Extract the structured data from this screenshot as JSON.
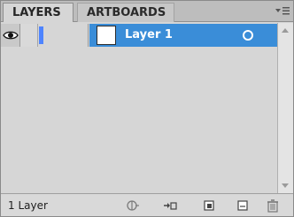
{
  "tabs": [
    "LAYERS",
    "ARTBOARDS"
  ],
  "panel_menu_icon": "panel-menu-icon",
  "layer": {
    "name": "Layer 1",
    "color": "#4e84ff",
    "visibility_icon": "eye-icon",
    "selected": true
  },
  "footer": {
    "layer_count": "1 Layer",
    "buttons": [
      "locate-object-icon",
      "make-clipping-mask-icon",
      "create-new-sublayer-icon",
      "create-new-layer-icon",
      "delete-selection-icon"
    ]
  },
  "colors": {
    "selection": "#3a8dd8",
    "panel_bg": "#d6d6d6",
    "tabbar_bg": "#bdbdbd"
  }
}
